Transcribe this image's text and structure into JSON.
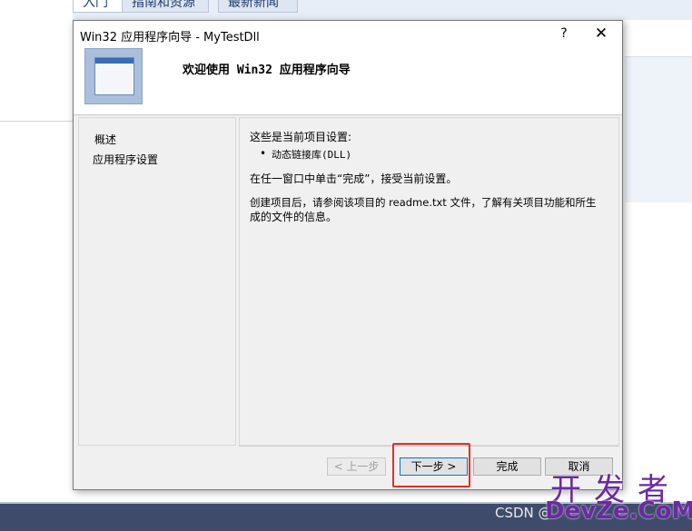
{
  "background": {
    "tabs": [
      "入门",
      "指南和资源",
      "最新新闻"
    ]
  },
  "dialog": {
    "title": "Win32 应用程序向导 - MyTestDll",
    "help_label": "?",
    "close_label": "✕",
    "header_title": "欢迎使用 Win32 应用程序向导",
    "nav": [
      "概述",
      "应用程序设置"
    ],
    "content": {
      "intro": "这些是当前项目设置:",
      "bullet_mark": "•",
      "setting": "动态链接库(DLL)",
      "finish_hint": "在任一窗口中单击“完成”，接受当前设置。",
      "readme_line1": "创建项目后，请参阅该项目的 readme.txt 文件，了解有关项目功能和所生",
      "readme_line2": "成的文件的信息。"
    },
    "buttons": {
      "prev": "< 上一步",
      "next": "下一步 >",
      "finish": "完成",
      "cancel": "取消"
    }
  },
  "watermark": {
    "csdn": "CSDN @",
    "kf": "开发者",
    "devze": "DevZe.CoM"
  },
  "colors": {
    "highlight": "#e0302a",
    "accent": "#0078d7"
  }
}
